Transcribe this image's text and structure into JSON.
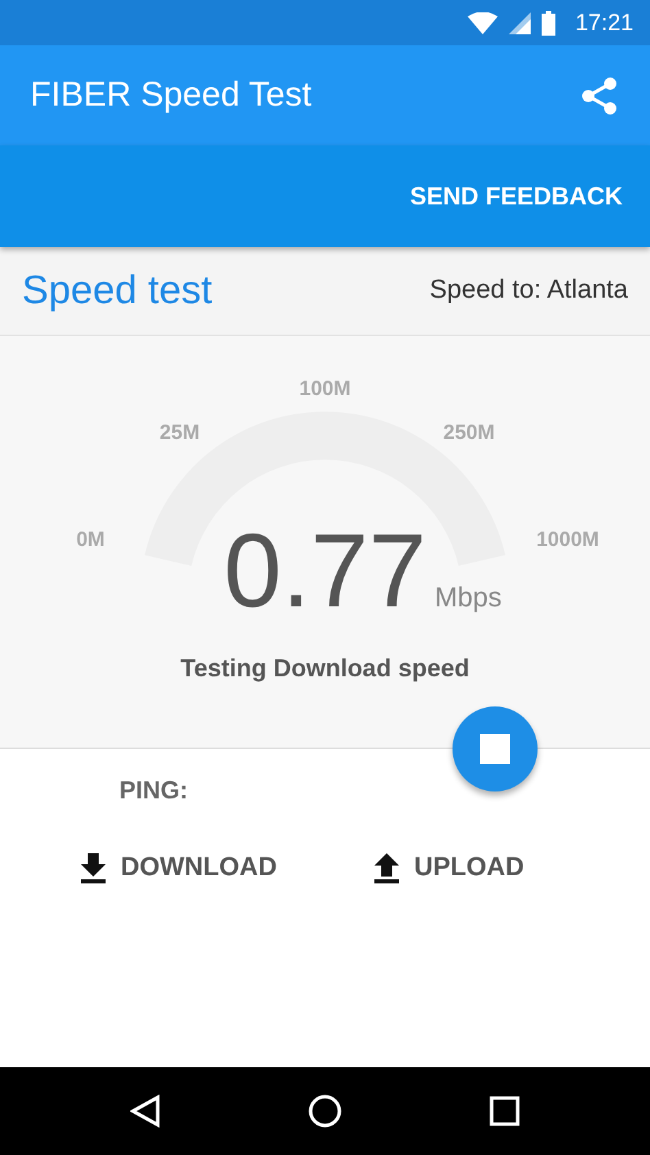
{
  "status_bar": {
    "time": "17:21"
  },
  "toolbar": {
    "title": "FIBER Speed Test"
  },
  "feedback_button": "SEND FEEDBACK",
  "header": {
    "title": "Speed test",
    "server": "Speed to: Atlanta"
  },
  "gauge": {
    "labels": [
      "0M",
      "25M",
      "100M",
      "250M",
      "1000M"
    ],
    "value": "0.77",
    "unit": "Mbps",
    "status": "Testing Download speed"
  },
  "results": {
    "ping": "PING:",
    "download": "DOWNLOAD",
    "upload": "UPLOAD"
  }
}
